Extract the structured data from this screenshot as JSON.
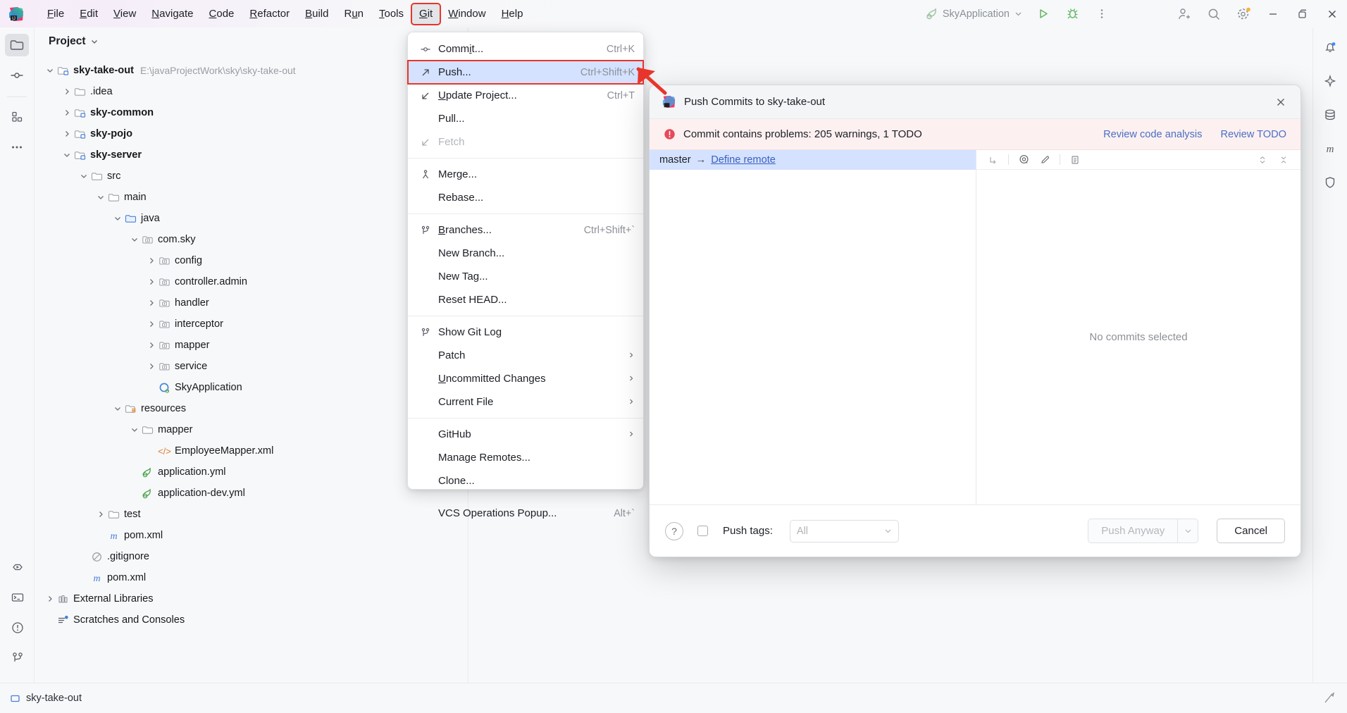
{
  "app": {
    "logo_icon": "intellij-idea-logo",
    "run_config": "SkyApplication",
    "window_title": "Push Commits to sky-take-out"
  },
  "menubar": {
    "items": [
      {
        "label": "File",
        "mnemonic": "F"
      },
      {
        "label": "Edit",
        "mnemonic": "E"
      },
      {
        "label": "View",
        "mnemonic": "V"
      },
      {
        "label": "Navigate",
        "mnemonic": "N"
      },
      {
        "label": "Code",
        "mnemonic": "C"
      },
      {
        "label": "Refactor",
        "mnemonic": "R"
      },
      {
        "label": "Build",
        "mnemonic": "B"
      },
      {
        "label": "Run",
        "mnemonic": "n"
      },
      {
        "label": "Tools",
        "mnemonic": "T"
      },
      {
        "label": "Git",
        "mnemonic": "G"
      },
      {
        "label": "Window",
        "mnemonic": "W"
      },
      {
        "label": "Help",
        "mnemonic": "H"
      }
    ],
    "active_index": 9
  },
  "toolbar_right": {
    "run_config_label": "SkyApplication",
    "buttons": [
      {
        "name": "run-button",
        "icon": "play-icon"
      },
      {
        "name": "debug-button",
        "icon": "bug-icon"
      },
      {
        "name": "more-actions-button",
        "icon": "kebab-menu-icon"
      },
      {
        "name": "code-with-me-button",
        "icon": "person-add-icon"
      },
      {
        "name": "search-everywhere-button",
        "icon": "search-icon"
      },
      {
        "name": "settings-button",
        "icon": "gear-icon"
      },
      {
        "name": "minimize-button",
        "icon": "minimize-icon"
      },
      {
        "name": "maximize-button",
        "icon": "restore-icon"
      },
      {
        "name": "close-button",
        "icon": "close-icon"
      }
    ]
  },
  "left_rail": {
    "top_items": [
      {
        "name": "project-tool-button",
        "icon": "folder-icon",
        "selected": true
      },
      {
        "name": "commit-tool-button",
        "icon": "commit-node-icon",
        "selected": false
      },
      {
        "name": "structure-tool-button",
        "icon": "structure-blocks-icon",
        "selected": false
      },
      {
        "name": "more-tool-windows-button",
        "icon": "ellipsis-icon",
        "selected": false
      }
    ],
    "bottom_items": [
      {
        "name": "run-tool-button",
        "icon": "run-hexagon-icon"
      },
      {
        "name": "terminal-tool-button",
        "icon": "terminal-icon"
      },
      {
        "name": "problems-tool-button",
        "icon": "warning-circle-icon"
      },
      {
        "name": "git-tool-button",
        "icon": "git-branch-icon"
      }
    ]
  },
  "right_rail": {
    "items": [
      {
        "name": "notifications-button",
        "icon": "bell-icon"
      },
      {
        "name": "ai-assistant-button",
        "icon": "ai-spark-icon"
      },
      {
        "name": "database-button",
        "icon": "database-icon"
      },
      {
        "name": "maven-button",
        "icon": "maven-m-icon"
      },
      {
        "name": "security-button",
        "icon": "shield-icon"
      }
    ]
  },
  "project_panel": {
    "title": "Project",
    "dropdown_icon": "chevron-down-icon",
    "tree": [
      {
        "depth": 0,
        "label": "sky-take-out",
        "path": "E:\\javaProjectWork\\sky\\sky-take-out",
        "icon": "module-folder-icon",
        "chevron": "down",
        "bold": true
      },
      {
        "depth": 1,
        "label": ".idea",
        "icon": "folder-icon",
        "chevron": "right"
      },
      {
        "depth": 1,
        "label": "sky-common",
        "icon": "module-folder-icon",
        "chevron": "right",
        "bold": true
      },
      {
        "depth": 1,
        "label": "sky-pojo",
        "icon": "module-folder-icon",
        "chevron": "right",
        "bold": true
      },
      {
        "depth": 1,
        "label": "sky-server",
        "icon": "module-folder-icon",
        "chevron": "down",
        "bold": true
      },
      {
        "depth": 2,
        "label": "src",
        "icon": "folder-icon",
        "chevron": "down"
      },
      {
        "depth": 3,
        "label": "main",
        "icon": "folder-icon",
        "chevron": "down"
      },
      {
        "depth": 4,
        "label": "java",
        "icon": "source-folder-icon",
        "chevron": "down"
      },
      {
        "depth": 5,
        "label": "com.sky",
        "icon": "package-icon",
        "chevron": "down"
      },
      {
        "depth": 6,
        "label": "config",
        "icon": "package-icon",
        "chevron": "right"
      },
      {
        "depth": 6,
        "label": "controller.admin",
        "icon": "package-icon",
        "chevron": "right"
      },
      {
        "depth": 6,
        "label": "handler",
        "icon": "package-icon",
        "chevron": "right"
      },
      {
        "depth": 6,
        "label": "interceptor",
        "icon": "package-icon",
        "chevron": "right"
      },
      {
        "depth": 6,
        "label": "mapper",
        "icon": "package-icon",
        "chevron": "right"
      },
      {
        "depth": 6,
        "label": "service",
        "icon": "package-icon",
        "chevron": "right"
      },
      {
        "depth": 6,
        "label": "SkyApplication",
        "icon": "spring-class-icon",
        "chevron": "none"
      },
      {
        "depth": 4,
        "label": "resources",
        "icon": "resources-folder-icon",
        "chevron": "down"
      },
      {
        "depth": 5,
        "label": "mapper",
        "icon": "folder-icon",
        "chevron": "down"
      },
      {
        "depth": 6,
        "label": "EmployeeMapper.xml",
        "icon": "xml-file-icon",
        "chevron": "none"
      },
      {
        "depth": 5,
        "label": "application.yml",
        "icon": "spring-yaml-icon",
        "chevron": "none"
      },
      {
        "depth": 5,
        "label": "application-dev.yml",
        "icon": "spring-yaml-icon",
        "chevron": "none"
      },
      {
        "depth": 3,
        "label": "test",
        "icon": "folder-icon",
        "chevron": "right"
      },
      {
        "depth": 3,
        "label": "pom.xml",
        "icon": "maven-m-icon",
        "chevron": "none"
      },
      {
        "depth": 2,
        "label": ".gitignore",
        "icon": "gitignore-icon",
        "chevron": "none"
      },
      {
        "depth": 2,
        "label": "pom.xml",
        "icon": "maven-m-icon",
        "chevron": "none"
      },
      {
        "depth": 0,
        "label": "External Libraries",
        "icon": "library-icon",
        "chevron": "right"
      },
      {
        "depth": 0,
        "label": "Scratches and Consoles",
        "icon": "scratches-icon",
        "chevron": "none"
      }
    ]
  },
  "git_menu": {
    "items": [
      {
        "label": "Commit...",
        "shortcut": "Ctrl+K",
        "icon": "commit-node-icon",
        "mnemonic": "i"
      },
      {
        "label": "Push...",
        "shortcut": "Ctrl+Shift+K",
        "icon": "push-arrow-icon",
        "selected": true,
        "highlight_box": true
      },
      {
        "label": "Update Project...",
        "shortcut": "Ctrl+T",
        "icon": "update-arrow-icon",
        "mnemonic": "U"
      },
      {
        "label": "Pull...",
        "shortcut": "",
        "icon": ""
      },
      {
        "label": "Fetch",
        "shortcut": "",
        "icon": "update-arrow-icon",
        "disabled": true
      },
      {
        "separator": true
      },
      {
        "label": "Merge...",
        "shortcut": "",
        "icon": "merge-icon"
      },
      {
        "label": "Rebase...",
        "shortcut": "",
        "icon": ""
      },
      {
        "separator": true
      },
      {
        "label": "Branches...",
        "shortcut": "Ctrl+Shift+`",
        "icon": "git-branch-icon",
        "mnemonic": "B"
      },
      {
        "label": "New Branch...",
        "shortcut": "",
        "icon": ""
      },
      {
        "label": "New Tag...",
        "shortcut": "",
        "icon": ""
      },
      {
        "label": "Reset HEAD...",
        "shortcut": "",
        "icon": ""
      },
      {
        "separator": true
      },
      {
        "label": "Show Git Log",
        "shortcut": "",
        "icon": "git-branch-icon"
      },
      {
        "label": "Patch",
        "shortcut": "",
        "icon": "",
        "submenu": true
      },
      {
        "label": "Uncommitted Changes",
        "shortcut": "",
        "icon": "",
        "submenu": true,
        "mnemonic": "U"
      },
      {
        "label": "Current File",
        "shortcut": "",
        "icon": "",
        "submenu": true
      },
      {
        "separator": true
      },
      {
        "label": "GitHub",
        "shortcut": "",
        "icon": "",
        "submenu": true
      },
      {
        "label": "Manage Remotes...",
        "shortcut": "",
        "icon": ""
      },
      {
        "label": "Clone...",
        "shortcut": "",
        "icon": ""
      },
      {
        "separator": true
      },
      {
        "label": "VCS Operations Popup...",
        "shortcut": "Alt+`",
        "icon": ""
      }
    ]
  },
  "push_dialog": {
    "title": "Push Commits to sky-take-out",
    "title_icon": "intellij-idea-logo",
    "close_icon": "close-icon",
    "banner": {
      "icon": "error-circle-icon",
      "text": "Commit contains problems: 205 warnings, 1 TODO",
      "links": [
        "Review code analysis",
        "Review TODO"
      ]
    },
    "commit_row": {
      "branch": "master",
      "arrow": "→",
      "remote_link": "Define remote"
    },
    "toolbar_icons": [
      {
        "name": "expand-all-icon"
      },
      {
        "name": "eye-preview-icon"
      },
      {
        "name": "edit-pencil-icon"
      },
      {
        "name": "list-view-icon"
      },
      {
        "name": "collapse-icon"
      },
      {
        "name": "expand-diff-icon"
      }
    ],
    "empty_state": "No commits selected",
    "footer": {
      "help_label": "?",
      "push_tags_label": "Push tags:",
      "push_tags_checked": false,
      "tags_select_value": "All",
      "push_button_label": "Push Anyway",
      "push_button_disabled": true,
      "push_dropdown_icon": "chevron-down-icon",
      "cancel_button_label": "Cancel"
    }
  },
  "statusbar": {
    "branch_label": "sky-take-out",
    "branch_icon": "module-folder-icon",
    "right_icon": "ide-inspection-icon"
  },
  "colors": {
    "accent_blue": "#4a6fc4",
    "selection_blue": "#d4e2ff",
    "error_red": "#e8352b",
    "banner_bg": "#fdf0f0",
    "link_blue": "#3b5fc0"
  }
}
